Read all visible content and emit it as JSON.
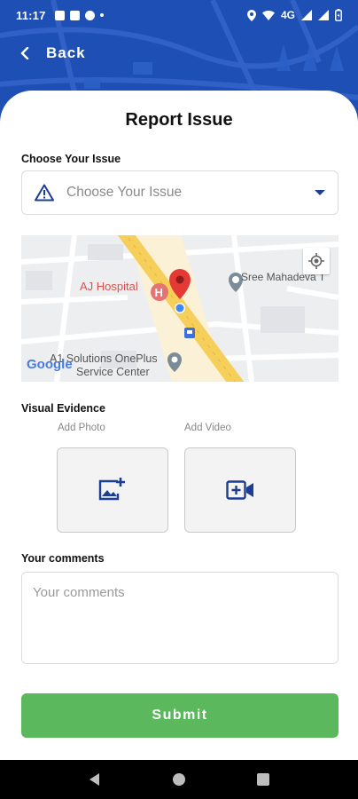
{
  "status_bar": {
    "time": "11:17",
    "network": "4G"
  },
  "header": {
    "back_label": "Back"
  },
  "page": {
    "title": "Report Issue"
  },
  "issue": {
    "label": "Choose Your Issue",
    "select_placeholder": "Choose Your Issue"
  },
  "map": {
    "places": [
      "AJ Hospital",
      "Sree Mahadeva T",
      "A1 Solutions OnePlus",
      "Service Center"
    ],
    "brand": "Google"
  },
  "evidence": {
    "label": "Visual Evidence",
    "photo_label": "Add Photo",
    "video_label": "Add Video"
  },
  "comments": {
    "label": "Your comments",
    "placeholder": "Your comments",
    "value": ""
  },
  "actions": {
    "submit_label": "Submit"
  },
  "colors": {
    "header_blue": "#1e4fb5",
    "accent_blue": "#1b3d94",
    "submit_green": "#5cb85c",
    "pin_red": "#e53935"
  }
}
